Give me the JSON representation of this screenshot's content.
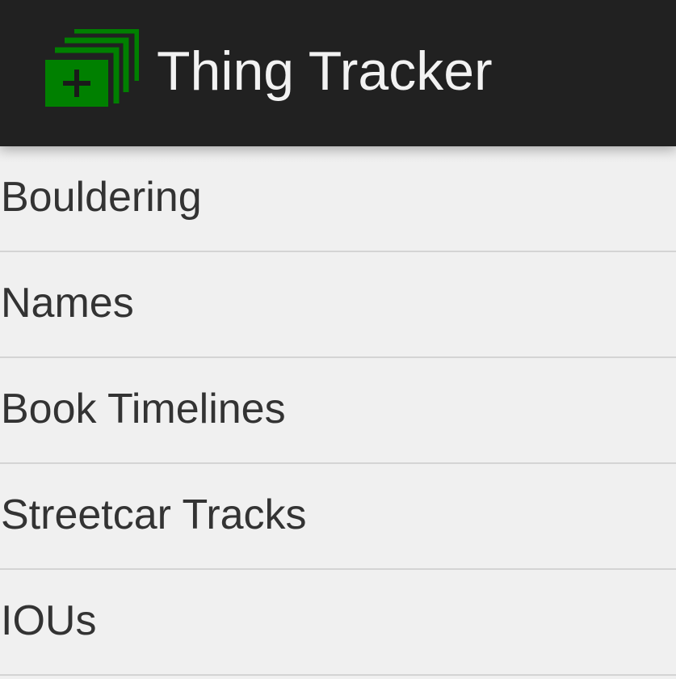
{
  "action_bar": {
    "title": "Thing Tracker",
    "icon": "stacked-green-squares-plus-icon"
  },
  "list": {
    "items": [
      {
        "label": "Bouldering"
      },
      {
        "label": "Names"
      },
      {
        "label": "Book Timelines"
      },
      {
        "label": "Streetcar Tracks"
      },
      {
        "label": "IOUs"
      }
    ]
  },
  "colors": {
    "action_bar_bg": "#212121",
    "title_text": "#f2f2f2",
    "icon_green": "#008000",
    "list_bg": "#f0f0f0",
    "list_text": "#333333",
    "divider": "#d4d4d4"
  }
}
